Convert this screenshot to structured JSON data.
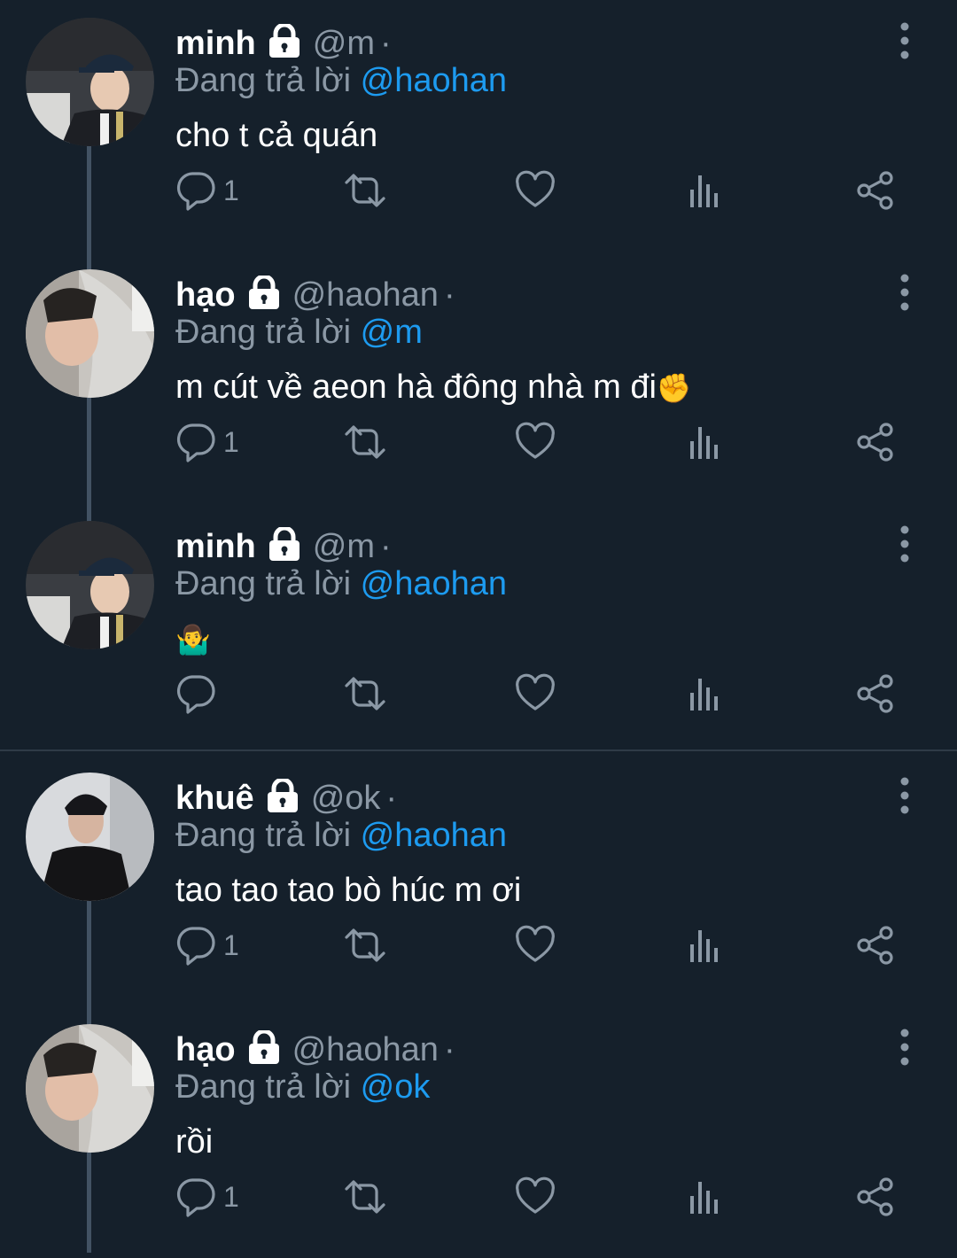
{
  "reply_prefix": "Đang trả lời",
  "colors": {
    "background": "#15202b",
    "mention": "#1d9bf0",
    "muted": "#8b98a5",
    "thread_line": "#425263"
  },
  "icons": [
    "lock-icon",
    "more-vertical-icon",
    "reply-icon",
    "retweet-icon",
    "like-icon",
    "views-icon",
    "share-icon",
    "facepalm-fist-emoji",
    "shrug-emoji"
  ],
  "tweets": [
    {
      "name": "minh",
      "handle": "@m",
      "dot": "·",
      "reply_to": "@haohan",
      "text": "cho t cả quán",
      "reply_count": "1",
      "avatar": "minh"
    },
    {
      "name": "hạo",
      "handle": "@haohan",
      "dot": "·",
      "reply_to": "@m",
      "text": "m cút về aeon hà đông nhà m đi",
      "emoji": "✊",
      "reply_count": "1",
      "avatar": "hao"
    },
    {
      "name": "minh",
      "handle": "@m",
      "dot": "·",
      "reply_to": "@haohan",
      "text": "",
      "emoji": "🤷‍♂️",
      "reply_count": "",
      "avatar": "minh"
    },
    {
      "name": "khuê",
      "handle": "@ok",
      "dot": "·",
      "reply_to": "@haohan",
      "text": "tao tao tao bò húc m ơi",
      "reply_count": "1",
      "avatar": "khue"
    },
    {
      "name": "hạo",
      "handle": "@haohan",
      "dot": "·",
      "reply_to": "@ok",
      "text": "rồi",
      "reply_count": "1",
      "avatar": "hao"
    }
  ]
}
